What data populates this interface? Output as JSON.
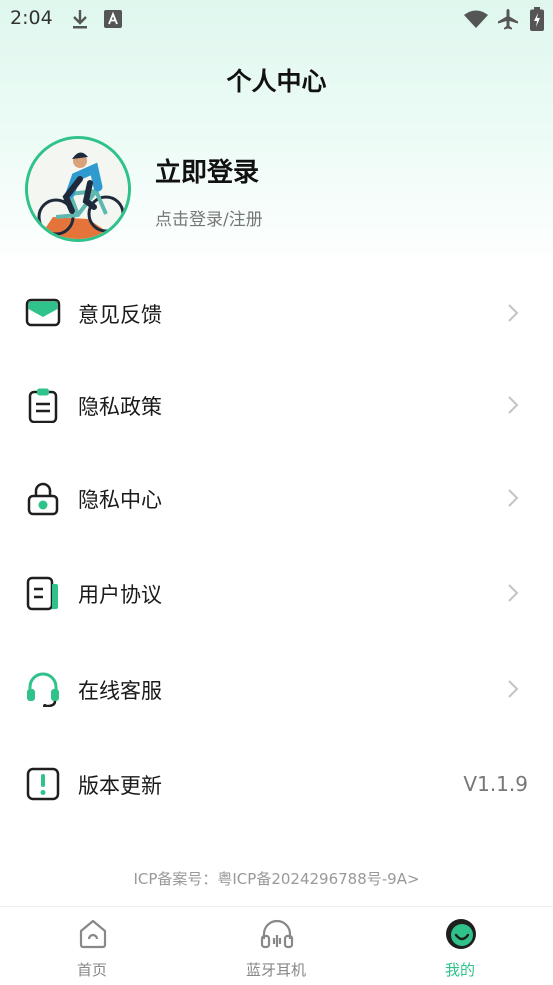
{
  "status_bar": {
    "time": "2:04",
    "left_icons": [
      "download-icon",
      "font-a-icon"
    ],
    "right_icons": [
      "wifi-icon",
      "airplane-icon",
      "battery-icon"
    ]
  },
  "page": {
    "title": "个人中心"
  },
  "profile": {
    "title": "立即登录",
    "subtitle": "点击登录/注册",
    "avatar_icon": "cyclist-avatar"
  },
  "menu": {
    "feedback": {
      "label": "意见反馈",
      "icon": "mail-icon"
    },
    "privacy_policy": {
      "label": "隐私政策",
      "icon": "clipboard-icon"
    },
    "privacy_center": {
      "label": "隐私中心",
      "icon": "lock-icon"
    },
    "user_agreement": {
      "label": "用户协议",
      "icon": "document-icon"
    },
    "customer_service": {
      "label": "在线客服",
      "icon": "headset-icon"
    },
    "version_update": {
      "label": "版本更新",
      "icon": "alert-icon",
      "value": "V1.1.9"
    }
  },
  "footer": {
    "icp": "ICP备案号：粤ICP备2024296788号-9A>"
  },
  "tabbar": {
    "home": {
      "label": "首页",
      "icon": "home-icon"
    },
    "earphone": {
      "label": "蓝牙耳机",
      "icon": "headphones-icon"
    },
    "mine": {
      "label": "我的",
      "icon": "smile-face-icon"
    }
  },
  "colors": {
    "accent": "#2fc28a",
    "text": "#1a1a1a",
    "muted": "#777777"
  }
}
